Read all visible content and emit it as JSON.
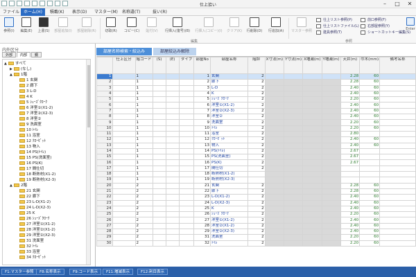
{
  "window": {
    "title": "仕上拾い",
    "min": "–",
    "max": "□",
    "close": "✕"
  },
  "menu": [
    "ファイル",
    "ホーム(H)",
    "積載(K)",
    "表示(D)",
    "マスター(M)",
    "名称違(T)",
    "抜い(R)"
  ],
  "ribbon": {
    "buttons": [
      "参照(I)",
      "編集(E)",
      "上書(S)",
      "部屋追加(I)",
      "部屋削除(R)",
      "切取(R)",
      "コピー(C)",
      "貼付(V)",
      "行挿入(復号)(B)",
      "行挿入(コピー)(I)",
      "クリア(K)",
      "行削除(D)",
      "行追加(A)",
      "マスター参照",
      "Enter"
    ],
    "group_edit": "編集",
    "group_ref": "参照",
    "small": [
      "仕上リスト参照(P)",
      "仕上リストファイル(L)",
      "建具参照(T)",
      "前口参照(F)",
      "右部屋参照(Y)",
      "ショートカットキー編集(S)"
    ]
  },
  "left": {
    "title": "内外区分",
    "tabs": [
      "外部",
      "内部",
      "鋼"
    ],
    "tree": [
      {
        "label": "すべて",
        "level": 0,
        "ex": "▲"
      },
      {
        "label": "(なし)",
        "level": 1,
        "ex": "▶"
      },
      {
        "label": "1階",
        "level": 1,
        "ex": "▲"
      },
      {
        "label": "1 玄関",
        "level": 2
      },
      {
        "label": "2 廊下",
        "level": 2
      },
      {
        "label": "3 L-D",
        "level": 2
      },
      {
        "label": "4 K",
        "level": 2
      },
      {
        "label": "5 ｼｭｰｽﾞｸﾛｰｸ",
        "level": 2
      },
      {
        "label": "6 洋室①(X1-2)",
        "level": 2
      },
      {
        "label": "7 洋室②(X2-3)",
        "level": 2
      },
      {
        "label": "8 洋室②",
        "level": 2
      },
      {
        "label": "9 洗面室",
        "level": 2
      },
      {
        "label": "10 ﾄｲﾚ",
        "level": 2
      },
      {
        "label": "11 浴室",
        "level": 2
      },
      {
        "label": "12 ｸﾛｰｾﾞｯﾄ",
        "level": 2
      },
      {
        "label": "13 物入",
        "level": 2
      },
      {
        "label": "14 PS(ﾄｲﾚ)",
        "level": 2
      },
      {
        "label": "15 PS(洗面室)",
        "level": 2
      },
      {
        "label": "16 PS(K)",
        "level": 2
      },
      {
        "label": "17 間仕切",
        "level": 2
      },
      {
        "label": "18 断熱材(X1-2)",
        "level": 2
      },
      {
        "label": "19 断熱材(X2-3)",
        "level": 2
      },
      {
        "label": "2階",
        "level": 1,
        "ex": "▲"
      },
      {
        "label": "21 玄関",
        "level": 2
      },
      {
        "label": "22 廊下",
        "level": 2
      },
      {
        "label": "23 L-D(X1-2)",
        "level": 2
      },
      {
        "label": "24 L-D(X2-3)",
        "level": 2
      },
      {
        "label": "25 K",
        "level": 2
      },
      {
        "label": "26 ｼｭｰｽﾞｸﾛｰｸ",
        "level": 2
      },
      {
        "label": "27 洋室①(X1-2)",
        "level": 2
      },
      {
        "label": "28 洋室②(X1-2)",
        "level": 2
      },
      {
        "label": "29 洋室②(X2-3)",
        "level": 2
      },
      {
        "label": "31 洗面室",
        "level": 2
      },
      {
        "label": "32 ﾄｲﾚ",
        "level": 2
      },
      {
        "label": "33 浴室",
        "level": 2
      },
      {
        "label": "34 ｸﾛｰｾﾞｯﾄ",
        "level": 2
      }
    ]
  },
  "tabs": [
    "部屋名称検索・絞込み",
    "部屋絞込み解除"
  ],
  "grid": {
    "headers": [
      "",
      "仕上区分",
      "階コード",
      "(S)",
      "(E)",
      "タイプ",
      "部屋No",
      "部屋名称",
      "階評",
      "X寸法(m)",
      "Y寸法(m)",
      "X増減(m)",
      "Y増減(m)",
      "天井(m)",
      "巾木(mm)",
      "備考名称"
    ],
    "rows": [
      {
        "n": "1",
        "floor": "1",
        "room_no": "1",
        "name": "玄関",
        "x": "2",
        "ceiling": "2.28",
        "base": "60"
      },
      {
        "n": "2",
        "floor": "1",
        "room_no": "2",
        "name": "廊下",
        "x": "2",
        "ceiling": "2.28",
        "base": "60"
      },
      {
        "n": "3",
        "floor": "1",
        "room_no": "3",
        "name": "L-D",
        "x": "2",
        "ceiling": "2.40",
        "base": "60"
      },
      {
        "n": "4",
        "floor": "1",
        "room_no": "4",
        "name": "K",
        "x": "2",
        "ceiling": "2.40",
        "base": "60"
      },
      {
        "n": "5",
        "floor": "1",
        "room_no": "5",
        "name": "ｼｭｰｽﾞｸﾛｰｸ",
        "x": "2",
        "ceiling": "2.20",
        "base": "60"
      },
      {
        "n": "6",
        "floor": "1",
        "room_no": "6",
        "name": "洋室①(X1-2)",
        "x": "2",
        "ceiling": "2.40",
        "base": "60"
      },
      {
        "n": "7",
        "floor": "1",
        "room_no": "7",
        "name": "洋室②(X2-3)",
        "x": "2",
        "ceiling": "2.40",
        "base": "60"
      },
      {
        "n": "8",
        "floor": "1",
        "room_no": "8",
        "name": "洋室②",
        "x": "2",
        "ceiling": "2.40",
        "base": "60"
      },
      {
        "n": "9",
        "floor": "1",
        "room_no": "9",
        "name": "洗面室",
        "x": "2",
        "ceiling": "2.20",
        "base": "60"
      },
      {
        "n": "10",
        "floor": "1",
        "room_no": "10",
        "name": "ﾄｲﾚ",
        "x": "2",
        "ceiling": "2.20",
        "base": "60"
      },
      {
        "n": "11",
        "floor": "1",
        "room_no": "11",
        "name": "浴室",
        "x": "2",
        "ceiling": "2.80",
        "base": ""
      },
      {
        "n": "12",
        "floor": "1",
        "room_no": "12",
        "name": "ｸﾛｰｾﾞｯﾄ",
        "x": "2",
        "ceiling": "2.40",
        "base": "60"
      },
      {
        "n": "13",
        "floor": "1",
        "room_no": "13",
        "name": "物入",
        "x": "2",
        "ceiling": "2.40",
        "base": "60"
      },
      {
        "n": "14",
        "floor": "1",
        "room_no": "14",
        "name": "PS(ﾄｲﾚ)",
        "x": "2",
        "ceiling": "2.67",
        "base": ""
      },
      {
        "n": "15",
        "floor": "1",
        "room_no": "15",
        "name": "PS(洗面室)",
        "x": "2",
        "ceiling": "2.67",
        "base": ""
      },
      {
        "n": "16",
        "floor": "1",
        "room_no": "16",
        "name": "PS(K)",
        "x": "2",
        "ceiling": "2.67",
        "base": ""
      },
      {
        "n": "17",
        "floor": "1",
        "room_no": "17",
        "name": "間仕切",
        "x": "2",
        "ceiling": "",
        "base": ""
      },
      {
        "n": "18",
        "floor": "1",
        "room_no": "18",
        "name": "断熱材(X1-2)",
        "x": "",
        "ceiling": "",
        "base": ""
      },
      {
        "n": "19",
        "floor": "1",
        "room_no": "19",
        "name": "断熱材(X2-3)",
        "x": "",
        "ceiling": "",
        "base": ""
      },
      {
        "n": "20",
        "floor": "2",
        "room_no": "21",
        "name": "玄関",
        "x": "2",
        "ceiling": "2.28",
        "base": "60"
      },
      {
        "n": "21",
        "floor": "2",
        "room_no": "22",
        "name": "廊下",
        "x": "2",
        "ceiling": "2.28",
        "base": "60"
      },
      {
        "n": "22",
        "floor": "2",
        "room_no": "23",
        "name": "L-D(X1-2)",
        "x": "2",
        "ceiling": "2.40",
        "base": "60"
      },
      {
        "n": "23",
        "floor": "2",
        "room_no": "24",
        "name": "L-D(X2-3)",
        "x": "2",
        "ceiling": "2.40",
        "base": "60"
      },
      {
        "n": "24",
        "floor": "2",
        "room_no": "25",
        "name": "K",
        "x": "2",
        "ceiling": "2.40",
        "base": "60"
      },
      {
        "n": "25",
        "floor": "2",
        "room_no": "26",
        "name": "ｼｭｰｽﾞｸﾛｰｸ",
        "x": "2",
        "ceiling": "2.20",
        "base": "60"
      },
      {
        "n": "26",
        "floor": "2",
        "room_no": "27",
        "name": "洋室①(X1-2)",
        "x": "2",
        "ceiling": "2.40",
        "base": "60"
      },
      {
        "n": "27",
        "floor": "2",
        "room_no": "28",
        "name": "洋室②(X1-2)",
        "x": "2",
        "ceiling": "2.40",
        "base": "60"
      },
      {
        "n": "28",
        "floor": "2",
        "room_no": "29",
        "name": "洋室②(X2-3)",
        "x": "2",
        "ceiling": "2.40",
        "base": "60"
      },
      {
        "n": "29",
        "floor": "2",
        "room_no": "31",
        "name": "洗面室",
        "x": "2",
        "ceiling": "2.20",
        "base": "60"
      },
      {
        "n": "30",
        "floor": "2",
        "room_no": "32",
        "name": "ﾄｲﾚ",
        "x": "2",
        "ceiling": "2.20",
        "base": "60"
      }
    ]
  },
  "fkeys": [
    "F1:マスター参照",
    "F8:名称表示",
    "F9:コード表示",
    "F11:増減表示",
    "F12:利目表示"
  ]
}
